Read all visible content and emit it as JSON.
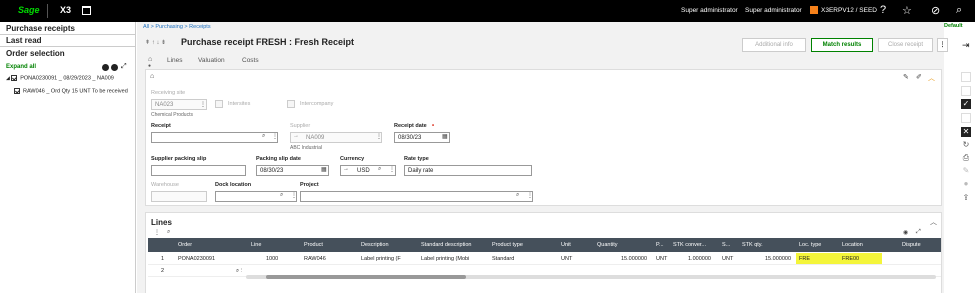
{
  "topbar": {
    "logo": "Sage",
    "app": "X3",
    "user1": "Super administrator",
    "user2": "Super administrator",
    "env": "X3ERPV12 / SEED",
    "default": "Default"
  },
  "left": {
    "purchase_receipts": "Purchase receipts",
    "last_read": "Last read",
    "order_selection": "Order selection",
    "expand_all": "Expand all",
    "tree_parent": "PONA0230091 _ 08/29/2023 _ NA009",
    "tree_child": "RAW046 _ Ord Qty 15 UNT To be received"
  },
  "header": {
    "breadcrumb": "All  >  Purchasing  >  Receipts",
    "title": "Purchase receipt FRESH : Fresh Receipt",
    "btn_additional": "Additional info",
    "btn_match": "Match results",
    "btn_close": "Close receipt"
  },
  "tabs": [
    "Lines",
    "Valuation",
    "Costs"
  ],
  "form": {
    "receiving_site_label": "Receiving site",
    "receiving_site_value": "NA023",
    "receiving_site_desc": "Chemical Products",
    "intersites": "Intersites",
    "intercompany": "Intercompany",
    "receipt_label": "Receipt",
    "supplier_label": "Supplier",
    "supplier_value": "NA009",
    "supplier_desc": "ABC Industrial",
    "receipt_date_label": "Receipt date",
    "receipt_date_value": "08/30/23",
    "supplier_slip_label": "Supplier packing slip",
    "slip_date_label": "Packing slip date",
    "slip_date_value": "08/30/23",
    "currency_label": "Currency",
    "currency_value": "USD",
    "rate_type_label": "Rate type",
    "rate_type_value": "Daily rate",
    "warehouse_label": "Warehouse",
    "dock_label": "Dock location",
    "project_label": "Project"
  },
  "lines": {
    "title": "Lines",
    "columns": [
      "Order",
      "Line",
      "Product",
      "Description",
      "Standard description",
      "Product type",
      "Unit",
      "Quantity",
      "P...",
      "STK conver...",
      "S...",
      "STK qty.",
      "Loc. type",
      "Location",
      "Dispute"
    ],
    "rows": [
      [
        "1",
        "PONA0230091",
        "1000",
        "RAW046",
        "Label printing (F",
        "Label printing (Mobi",
        "Standard",
        "UNT",
        "15.000000",
        "UNT",
        "1.000000",
        "UNT",
        "15.000000",
        "FRE",
        "FRE00",
        ""
      ],
      [
        "2",
        "",
        "",
        "",
        "",
        "",
        "",
        "",
        "",
        "",
        "",
        "",
        "",
        "",
        "",
        ""
      ]
    ]
  }
}
